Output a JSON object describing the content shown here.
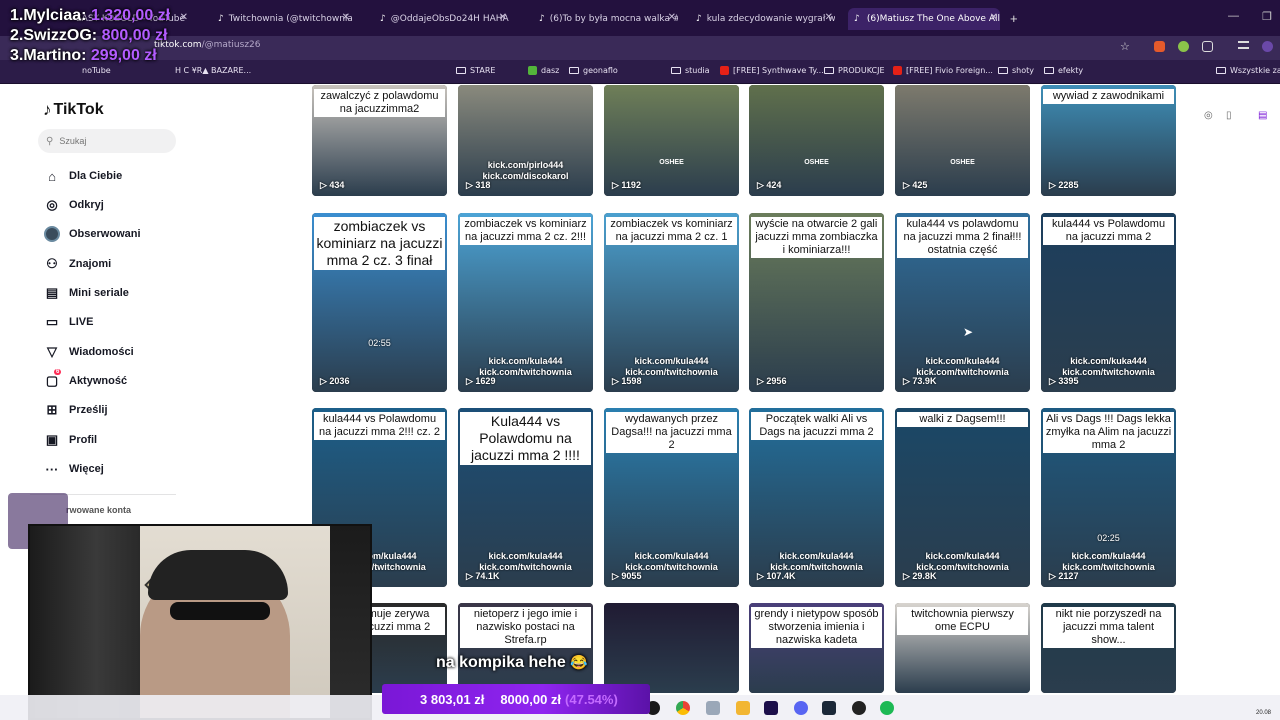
{
  "browser": {
    "tabs": [
      {
        "label": "EASY KOBOLD - YouTube"
      },
      {
        "label": "Twitchownia (@twitchownia_)"
      },
      {
        "label": "@OddajeObsDo24H HAHAHA"
      },
      {
        "label": "(6)To by była mocna walka #jac"
      },
      {
        "label": "kula zdecydowanie wygrał walk"
      },
      {
        "label": "(6)Matiusz The One Above All"
      }
    ],
    "url_host": "tiktok.com",
    "url_path": "/@matiusz26",
    "bookmarks": [
      "noTube",
      "H C ¥R▲ BAZARE...",
      "STARE",
      "dasz",
      "geonaflo",
      "studia",
      "[FREE] Synthwave Ty...",
      "PRODUKCJE",
      "[FREE] Fivio Foreign...",
      "shoty",
      "efekty",
      "Wszystkie zakładki"
    ]
  },
  "overlay": {
    "scores": [
      {
        "name": "1.Mylciaa:",
        "amount": "1.320,00 zł"
      },
      {
        "name": "2.SwizzOG:",
        "amount": "800,00 zł"
      },
      {
        "name": "3.Martino:",
        "amount": "299,00 zł"
      }
    ],
    "subtitle": "na kompika hehe",
    "subtitle_emoji": "😂",
    "donation": {
      "current": "3 803,01 zł",
      "goal": "8000,00 zł",
      "percent": "(47.54%)"
    }
  },
  "tiktok": {
    "logo": "TikTok",
    "search_placeholder": "Szukaj",
    "nav": [
      {
        "label": "Dla Ciebie",
        "icon": "home-icon"
      },
      {
        "label": "Odkryj",
        "icon": "compass-icon"
      },
      {
        "label": "Obserwowani",
        "icon": "avatar-icon"
      },
      {
        "label": "Znajomi",
        "icon": "friends-icon"
      },
      {
        "label": "Mini seriale",
        "icon": "series-icon"
      },
      {
        "label": "LIVE",
        "icon": "live-icon"
      },
      {
        "label": "Wiadomości",
        "icon": "messages-icon"
      },
      {
        "label": "Aktywność",
        "icon": "activity-icon",
        "badge": "6"
      },
      {
        "label": "Prześlij",
        "icon": "upload-icon"
      },
      {
        "label": "Profil",
        "icon": "profile-icon"
      },
      {
        "label": "Więcej",
        "icon": "more-icon"
      }
    ],
    "followed_label": "rwowane konta"
  },
  "videos": [
    {
      "caption": "zawalczyć z polawdomu na jacuzzimma2",
      "views": "434",
      "kick": "",
      "bg": "#c8c3bd"
    },
    {
      "caption": "",
      "views": "318",
      "kick": "kick.com/pirlo444 kick.com/discokarol",
      "bg": "#8a8a7d"
    },
    {
      "caption": "",
      "views": "1192",
      "kick": "",
      "bg": "#6f7f58",
      "oshee": "OSHEE"
    },
    {
      "caption": "",
      "views": "424",
      "kick": "",
      "bg": "#60704c",
      "oshee": "OSHEE"
    },
    {
      "caption": "",
      "views": "425",
      "kick": "",
      "bg": "#7d7a6d",
      "oshee": "OSHEE"
    },
    {
      "caption": "wywiad z zawodnikami",
      "views": "2285",
      "kick": "",
      "bg": "#3e8fb8"
    },
    {
      "caption": "zombiaczek vs kominiarz na jacuzzi mma 2 cz. 3 finał",
      "views": "2036",
      "kick": "",
      "bg": "#3a8ed0",
      "dur": "02:55",
      "big": true
    },
    {
      "caption": "zombiaczek vs kominiarz na jacuzzi mma 2 cz. 2!!!",
      "views": "1629",
      "kick": "kick.com/kula444 kick.com/twitchownia",
      "bg": "#4ca4d6"
    },
    {
      "caption": "zombiaczek vs kominiarz na jacuzzi mma 2 cz. 1",
      "views": "1598",
      "kick": "kick.com/kula444 kick.com/twitchownia",
      "bg": "#4ba0cf"
    },
    {
      "caption": "wyście na otwarcie 2 gali jacuzzi mma zombiaczka i kominiarza!!!",
      "views": "2956",
      "kick": "",
      "bg": "#6b7d5b"
    },
    {
      "caption": "kula444 vs polawdomu na jacuzzi mma 2 finał!!! ostatnia część",
      "views": "73.9K",
      "kick": "kick.com/kula444 kick.com/twitchownia",
      "bg": "#2f6f9e"
    },
    {
      "caption": "kula444 vs Polawdomu na jacuzzi mma 2",
      "views": "3395",
      "kick": "kick.com/kuka444 kick.com/twitchownia",
      "bg": "#1c3f5e"
    },
    {
      "caption": "kula444 vs Polawdomu na jacuzzi mma 2!!! cz. 2",
      "views": "",
      "kick": "kick.com/kula444 kick.com/twitchownia",
      "bg": "#1c5f8a"
    },
    {
      "caption": "Kula444 vs Polawdomu na jacuzzi mma 2 !!!!",
      "views": "74.1K",
      "kick": "kick.com/kula444 kick.com/twitchownia",
      "bg": "#1b4f78",
      "big": true
    },
    {
      "caption": "wydawanych przez Dagsa!!! na jacuzzi mma 2",
      "views": "9055",
      "kick": "kick.com/kula444 kick.com/twitchownia",
      "bg": "#2a7fb0"
    },
    {
      "caption": "Początek walki Ali vs Dags na jacuzzi mma 2",
      "views": "107.4K",
      "kick": "kick.com/kula444 kick.com/twitchownia",
      "bg": "#226f9c"
    },
    {
      "caption": "walki z Dagsem!!!",
      "views": "29.8K",
      "kick": "kick.com/kula444 kick.com/twitchownia",
      "bg": "#1a4868"
    },
    {
      "caption": "Ali vs Dags !!! Dags lekka zmyłka na Alim na jacuzzi mma 2",
      "views": "2127",
      "kick": "kick.com/kula444 kick.com/twitchownia",
      "bg": "#1d5a82",
      "dur": "02:25"
    },
    {
      "caption": "wnia hamuje zerywa walke jacuzzi mma 2",
      "views": "",
      "kick": "",
      "bg": "#2a2a2a"
    },
    {
      "caption": "nietoperz i jego imie i nazwisko postaci na Strefa.rp",
      "views": "",
      "kick": "",
      "bg": "#3a3648"
    },
    {
      "caption": "",
      "views": "",
      "kick": "",
      "bg": "#201b33"
    },
    {
      "caption": "grendy i nietypow sposób stworzenia imienia i nazwiska kadeta",
      "views": "",
      "kick": "",
      "bg": "#4a3f7a"
    },
    {
      "caption": "twitchownia pierwszy ome ECPU",
      "views": "",
      "kick": "",
      "bg": "#d8d4cf"
    },
    {
      "caption": "nikt nie porzyszedł na jacuzzi mma talent show...",
      "views": "",
      "kick": "",
      "bg": "#1f3a4a"
    }
  ],
  "taskbar": {
    "clock": "20.08"
  }
}
